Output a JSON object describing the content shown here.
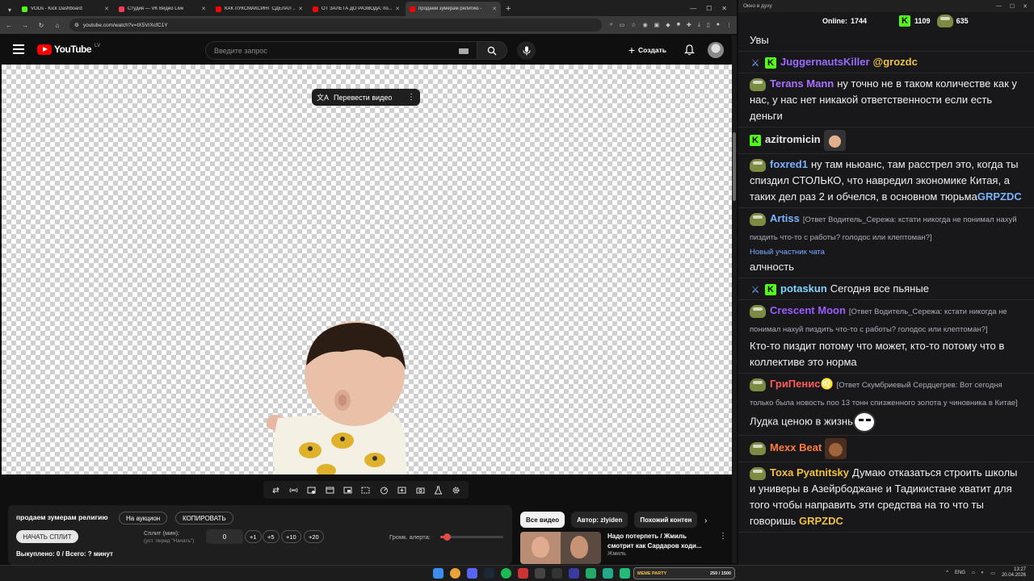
{
  "browser": {
    "tabs": [
      {
        "title": "VODs - Kick Dashboard",
        "fav": "#53fc18"
      },
      {
        "title": "Студия — VK Видео Live",
        "fav": "#ff3b5c"
      },
      {
        "title": "КАК ЛУКСМАКСИНГ СДЕЛАЛ ...",
        "fav": "#ff0000"
      },
      {
        "title": "ОТ ЗАЛЕТА ДО РАЗВОДА: по...",
        "fav": "#ff0000"
      },
      {
        "title": "продаем зумерам религию -",
        "fav": "#ff0000"
      }
    ],
    "url": "youtube.com/watch?v=tX5VrXcfC1Y"
  },
  "youtube": {
    "brand": "YouTube",
    "region": "LV",
    "search_placeholder": "Введите запрос",
    "create_label": "Создать",
    "translate_label": "Перевести видео",
    "chips": [
      "Все видео",
      "Автор: zlyiden",
      "Похожий контен"
    ],
    "rec": {
      "title": "Надо потерпеть / Жмиль смотрит как Сардаров ходи...",
      "author": "Жмиль"
    }
  },
  "split_panel": {
    "title": "продаем зумерам религию",
    "auction_label": "На аукцион",
    "copy_label": "КОПИРОВАТЬ",
    "start_label": "НАЧАТЬ СПЛИТ",
    "split_label": "Сплит (мин):",
    "split_sub": "(уст. перед \"Начать\")",
    "split_value": "0",
    "increments": [
      "+1",
      "+5",
      "+10",
      "+20"
    ],
    "volume_label": "Громк. алерта:",
    "volume_level": 0.1,
    "stats": "Выкуплено: 0 / Всего: ? минут"
  },
  "chat": {
    "window_title": "Окно в духу",
    "online_label": "Online:",
    "online_count": "1744",
    "kick_count": "1109",
    "pepe_count": "635",
    "messages": [
      {
        "text": "Увы"
      },
      {
        "user": "JuggernautsKiller",
        "color": "#9b6bff",
        "mention": "@grozdc"
      },
      {
        "user": "Terans Mann",
        "color": "#a970ff",
        "text": "ну точно не в таком количестве как у нас, у нас нет никакой ответственности если есть деньги"
      },
      {
        "user": "azitromicin",
        "color": "#e8e8e8"
      },
      {
        "user": "foxred1",
        "color": "#7cb3ff",
        "text": "ну там ньюанс, там расстрел это, когда ты спиздил СТОЛЬКО, что навредил экономике Китая, а таких дел раз 2 и обчелся, в основном тюрьма",
        "tag": "GRPZDC"
      },
      {
        "user": "Artiss",
        "color": "#7cb3ff",
        "reply": "[Ответ Водитель_Сережа: кстати никогда не понимал нахуй пиздить что-то с работы? голодос или клептоман?]",
        "new": "Новый участник чата",
        "text": "алчность"
      },
      {
        "user": "potaskun",
        "color": "#7fd4ff",
        "text": "Сегодня все пьяные"
      },
      {
        "user": "Crescent Moon",
        "color": "#9b5cff",
        "reply": "[Ответ Водитель_Сережа: кстати никогда не понимал нахуй пиздить что-то с работы? голодос или клептоман?]",
        "text": "Кто-то пиздит потому что может, кто-то потому что в коллективе это норма"
      },
      {
        "user": "ГриПенис♌",
        "color": "#ff5a5a",
        "reply": "[Ответ Скумбриевый Сердцегрев: Вот сегодня только была новость поо 13 тонн спизженного золота у чиновника в Китае]",
        "text": "Лудка ценою в жизнь"
      },
      {
        "user": "Mexx Beat",
        "color": "#ff7b3a"
      },
      {
        "user": "Toxa Pyatnitsky",
        "color": "#f2c040",
        "text": "Думаю отказаться строить школы и универы в Азейрбоджане и Тадикистане хватит для того чтобы направить эти средства на то что ты говоришь",
        "tag": "GRPZDC"
      }
    ]
  },
  "taskbar": {
    "meme_name": "MEME PARTY",
    "meme_value": "250 / 1500",
    "lang": "ENG",
    "time": "13:27",
    "date": "20.04.2026"
  }
}
